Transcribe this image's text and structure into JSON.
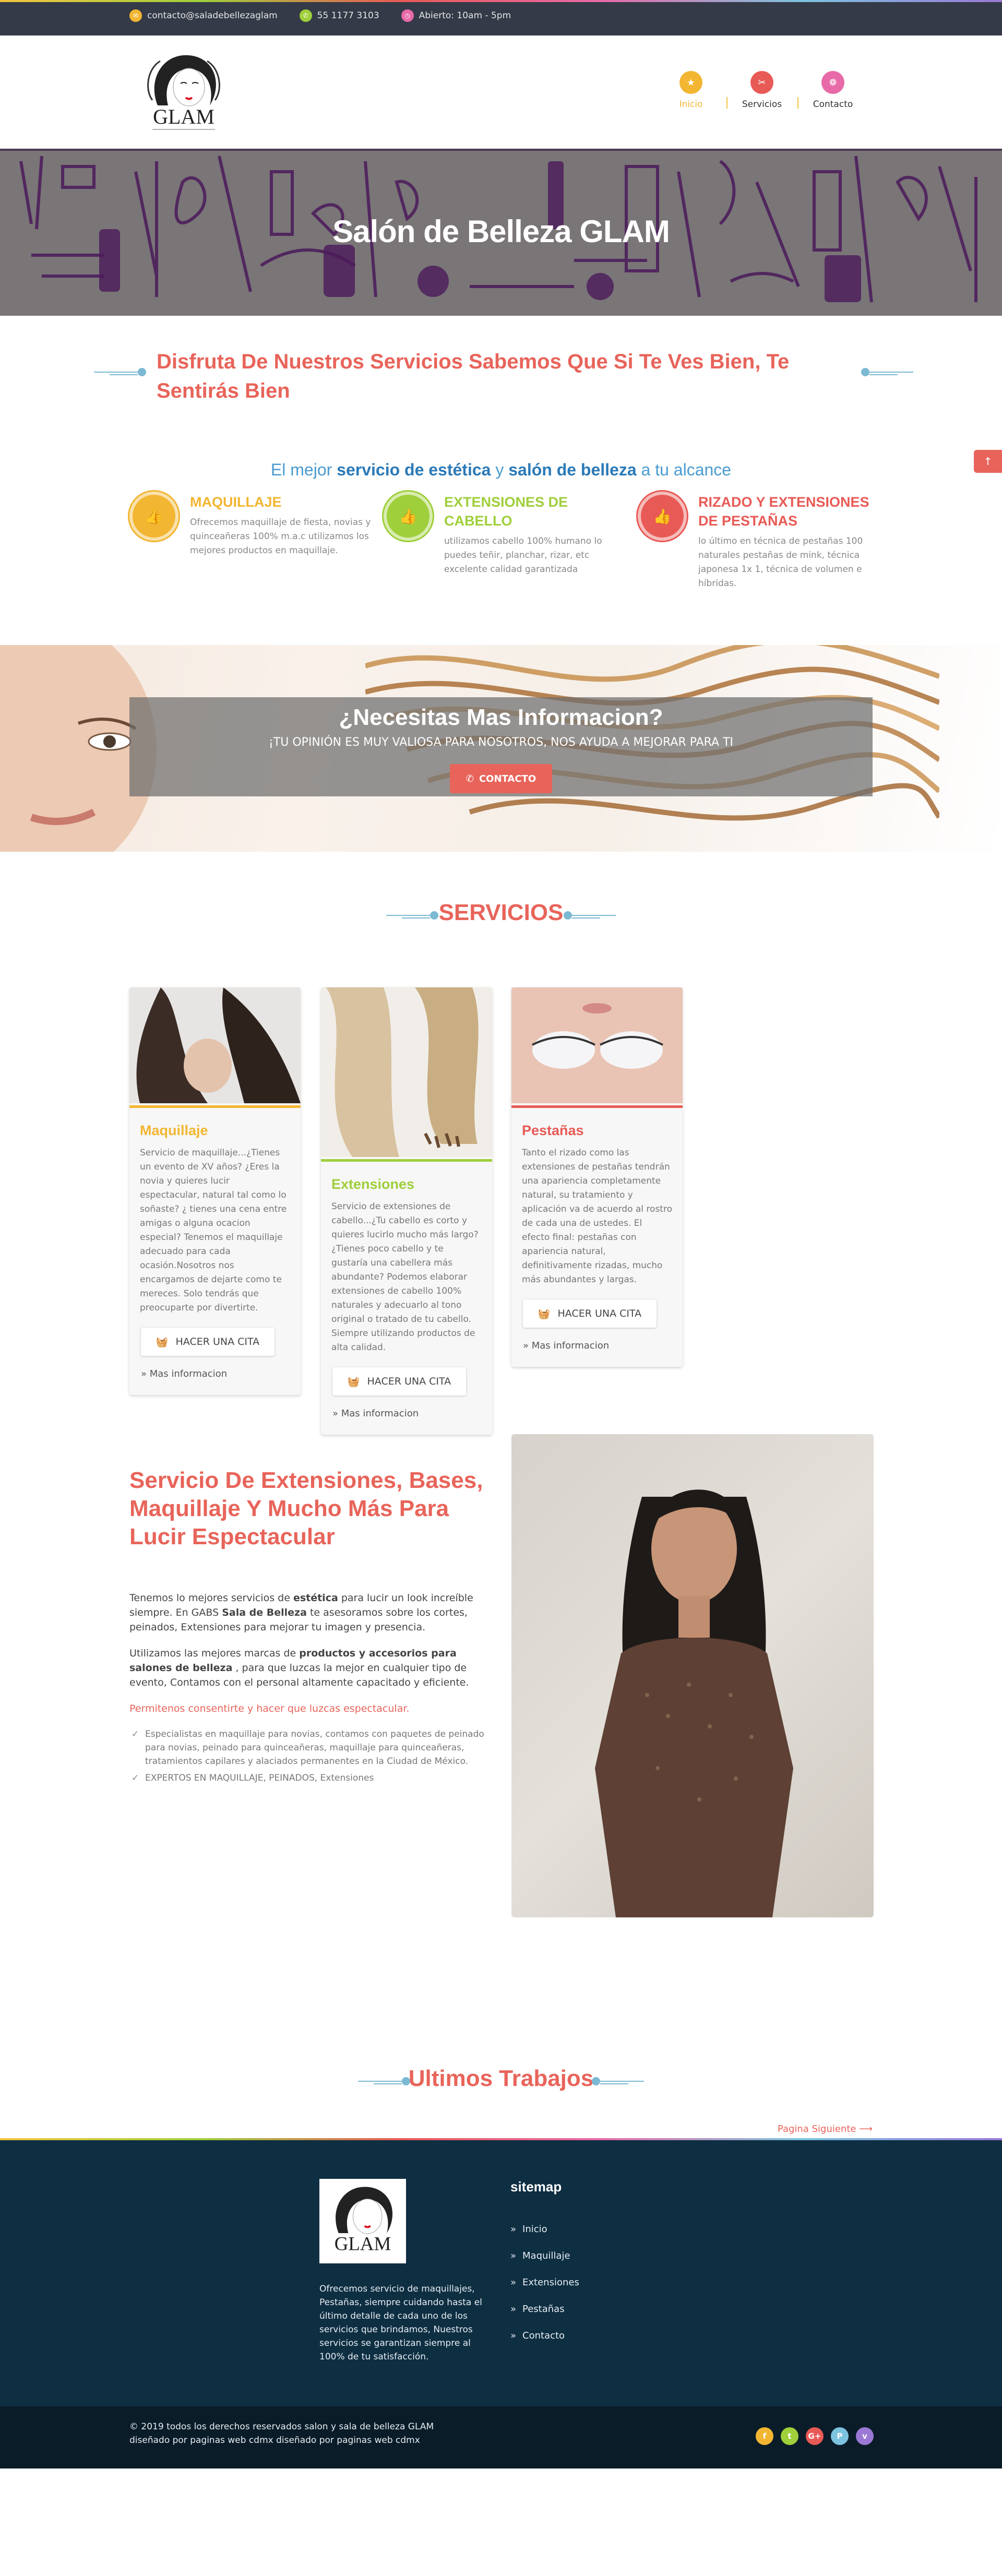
{
  "topbar": {
    "email": "contacto@saladebellezaglam",
    "phone": "55 1177 3103",
    "hours": "Abierto: 10am - 5pm"
  },
  "logo": {
    "text": "GLAM"
  },
  "nav": {
    "items": [
      {
        "label": "Inicio",
        "icon": "star-icon",
        "color": "#f2b632"
      },
      {
        "label": "Servicios",
        "icon": "cut-icon",
        "color": "#e85a56"
      },
      {
        "label": "Contacto",
        "icon": "gift-icon",
        "color": "#e86aa8"
      }
    ]
  },
  "hero": {
    "title": "Salón de Belleza GLAM"
  },
  "intro": {
    "heading": "Disfruta De Nuestros Servicios Sabemos Que Si Te Ves Bien, Te Sentirás Bien",
    "tag_pre": "El mejor ",
    "tag_b1": "servicio de estética",
    "tag_mid": " y ",
    "tag_b2": "salón de belleza",
    "tag_post": " a tu alcance"
  },
  "features": [
    {
      "title": "MAQUILLAJE",
      "text": "Ofrecemos maquillaje de fiesta, novias y quinceañeras 100% m.a.c utilizamos los mejores productos en maquillaje.",
      "color": "#f2b632"
    },
    {
      "title": "EXTENSIONES DE CABELLO",
      "text": "utilizamos cabello 100% humano lo puedes teñir, planchar, rizar, etc excelente calidad garantizada",
      "color": "#9fcf3b"
    },
    {
      "title": "RIZADO Y EXTENSIONES DE PESTAÑAS",
      "text": "lo último en técnica de pestañas 100 naturales pestañas de mink, técnica japonesa 1x 1, técnica de volumen e híbridas.",
      "color": "#e85a56"
    }
  ],
  "info": {
    "title": "¿Necesitas Mas Informacion?",
    "subtitle": "¡TU OPINIÓN ES MUY VALIOSA PARA NOSOTROS, NOS AYUDA A MEJORAR PARA TI",
    "button": "CONTACTO"
  },
  "services": {
    "title": "SERVICIOS",
    "cards": [
      {
        "title": "Maquillaje",
        "color": "#f2b632",
        "text": "Servicio de maquillaje...¿Tienes un evento de XV años? ¿Eres la novia y quieres lucir espectacular, natural tal como lo soñaste? ¿ tienes una cena entre amigas o alguna ocacion especial? Tenemos el maquillaje adecuado para cada ocasión.Nosotros nos encargamos de dejarte como te mereces. Solo tendrás que preocuparte por divertirte.",
        "button": "HACER UNA CITA",
        "link": "Mas informacion"
      },
      {
        "title": "Extensiones",
        "color": "#9fcf3b",
        "text": "Servicio de extensiones de cabello...¿Tu cabello es corto y quieres lucirlo mucho más largo? ¿Tienes poco cabello y te gustaría una cabellera más abundante? Podemos elaborar extensiones de cabello 100% naturales y adecuarlo al tono original o tratado de tu cabello. Siempre utilizando productos de alta calidad.",
        "button": "HACER UNA CITA",
        "link": "Mas informacion"
      },
      {
        "title": "Pestañas",
        "color": "#e85a56",
        "text": "Tanto el rizado como las extensiones de pestañas tendrán una apariencia completamente natural, su tratamiento y aplicación va de acuerdo al rostro de cada una de ustedes. El efecto final: pestañas con apariencia natural, definitivamente rizadas, mucho más abundantes y largas.",
        "button": "HACER UNA CITA",
        "link": "Mas informacion"
      }
    ]
  },
  "about": {
    "heading": "Servicio De Extensiones, Bases, Maquillaje Y Mucho Más Para Lucir Espectacular",
    "p1a": "Tenemos lo mejores servicios de ",
    "p1b": "estética",
    "p1c": " para lucir un look increíble siempre. En GABS ",
    "p1d": "Sala de Belleza",
    "p1e": " te asesoramos sobre los cortes, peinados, Extensiones para mejorar tu imagen y presencia.",
    "p2a": "Utilizamos las mejores marcas de ",
    "p2b": "productos y accesorios para salones de belleza",
    "p2c": " , para que luzcas la mejor en cualquier tipo de evento, Contamos con el personal altamente capacitado y eficiente.",
    "p3": "Permitenos consentirte y hacer que luzcas espectacular.",
    "bullets": [
      "Especialistas en maquillaje para novias, contamos con paquetes de peinado para novias, peinado para quinceañeras, maquillaje para quinceañeras, tratamientos capilares y alaciados permanentes en la Ciudad de México.",
      "EXPERTOS EN MAQUILLAJE, PEINADOS, Extensiones"
    ]
  },
  "works": {
    "title": "Ultimos Trabajos",
    "next": "Pagina Siguiente ⟶"
  },
  "footer": {
    "desc": "Ofrecemos servicio de maquillajes, Pestañas, siempre cuidando hasta el último detalle de cada uno de los servicios que brindamos, Nuestros servicios se garantizan siempre al 100% de tu satisfacción.",
    "sitemap_title": "sitemap",
    "links": [
      "Inicio",
      "Maquillaje",
      "Extensiones",
      "Pestañas",
      "Contacto"
    ],
    "copy1": "© 2019 todos los derechos reservados salon y sala de belleza GLAM",
    "copy2": "diseñado por paginas web cdmx diseñado por paginas web cdmx",
    "social": [
      {
        "icon": "facebook-icon",
        "glyph": "f",
        "color": "#f2b632"
      },
      {
        "icon": "twitter-icon",
        "glyph": "t",
        "color": "#9fcf3b"
      },
      {
        "icon": "google-plus-icon",
        "glyph": "G+",
        "color": "#e85a56"
      },
      {
        "icon": "pinterest-icon",
        "glyph": "P",
        "color": "#7cc3df"
      },
      {
        "icon": "vimeo-icon",
        "glyph": "v",
        "color": "#9b78d6"
      }
    ]
  }
}
